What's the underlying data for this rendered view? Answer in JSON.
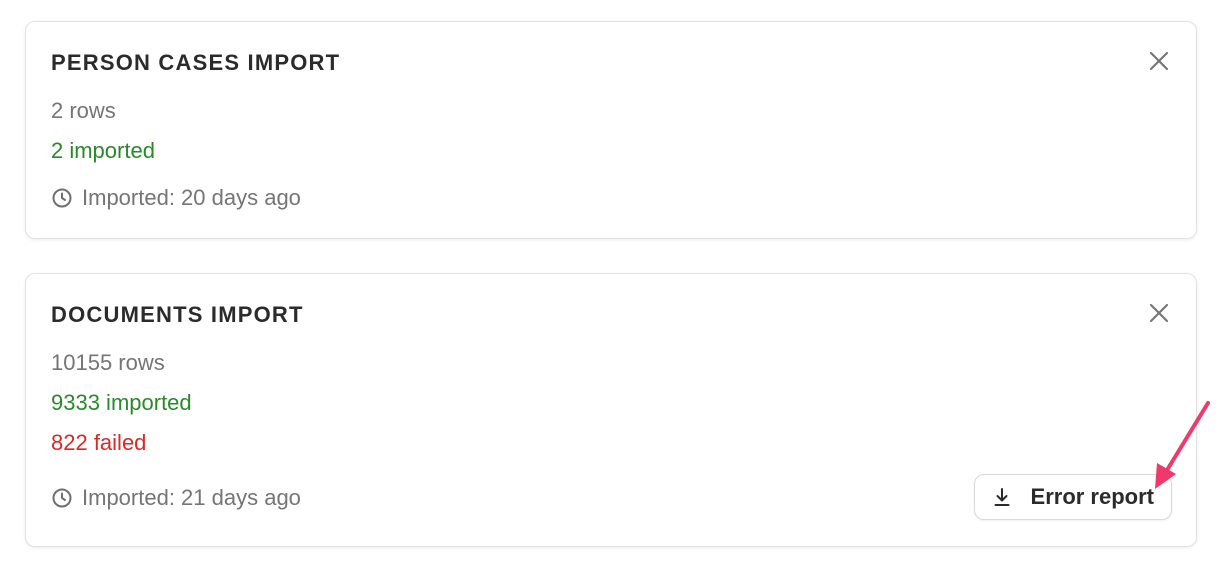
{
  "imports": [
    {
      "title": "PERSON CASES IMPORT",
      "rows": "2 rows",
      "imported": "2 imported",
      "timestamp": "Imported: 20 days ago"
    },
    {
      "title": "DOCUMENTS IMPORT",
      "rows": "10155 rows",
      "imported": "9333 imported",
      "failed": "822 failed",
      "timestamp": "Imported: 21 days ago",
      "error_report_label": "Error report"
    }
  ],
  "icons": {
    "close": "close-icon",
    "clock": "clock-icon",
    "download": "download-icon"
  },
  "colors": {
    "success": "#2a8a2a",
    "failure": "#d72a2a",
    "muted": "#757575",
    "annotation_arrow": "#f0386b"
  }
}
